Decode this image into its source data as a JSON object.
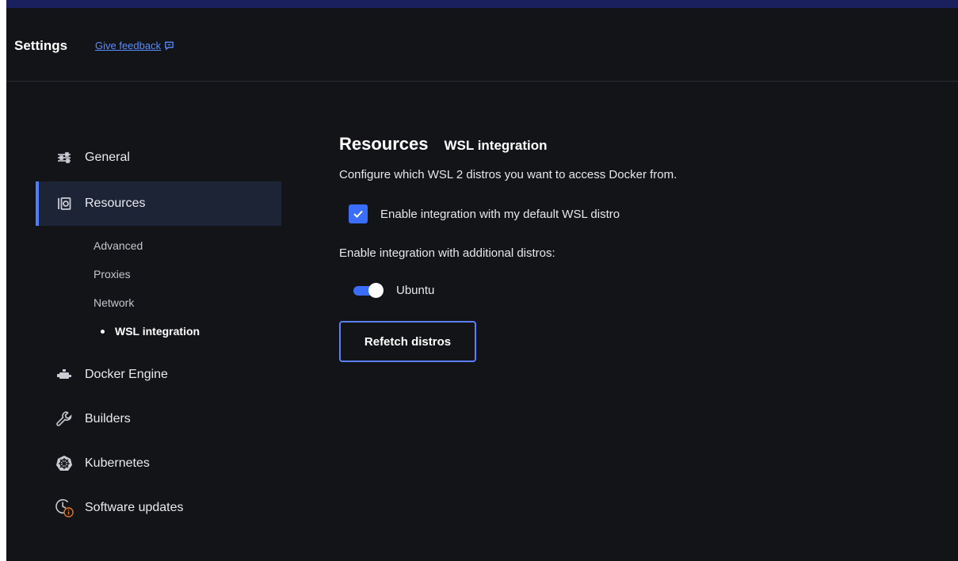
{
  "header": {
    "title": "Settings",
    "feedback_label": "Give feedback"
  },
  "sidebar": {
    "items": [
      {
        "label": "General",
        "icon": "sliders-icon"
      },
      {
        "label": "Resources",
        "icon": "resources-icon",
        "active": true
      },
      {
        "label": "Docker Engine",
        "icon": "docker-engine-icon"
      },
      {
        "label": "Builders",
        "icon": "wrench-icon"
      },
      {
        "label": "Kubernetes",
        "icon": "kubernetes-icon"
      },
      {
        "label": "Software updates",
        "icon": "software-updates-icon"
      }
    ],
    "sub_items": [
      {
        "label": "Advanced"
      },
      {
        "label": "Proxies"
      },
      {
        "label": "Network"
      },
      {
        "label": "WSL integration",
        "current": true
      }
    ]
  },
  "main": {
    "title": "Resources",
    "subtitle": "WSL integration",
    "description": "Configure which WSL 2 distros you want to access Docker from.",
    "default_distro": {
      "label": "Enable integration with my default WSL distro",
      "checked": true
    },
    "additional_label": "Enable integration with additional distros:",
    "distros": [
      {
        "name": "Ubuntu",
        "enabled": true
      }
    ],
    "refetch_label": "Refetch distros"
  },
  "colors": {
    "accent": "#3b6dfb",
    "background": "#131418",
    "link": "#5b8cff",
    "warning": "#e8741f"
  }
}
